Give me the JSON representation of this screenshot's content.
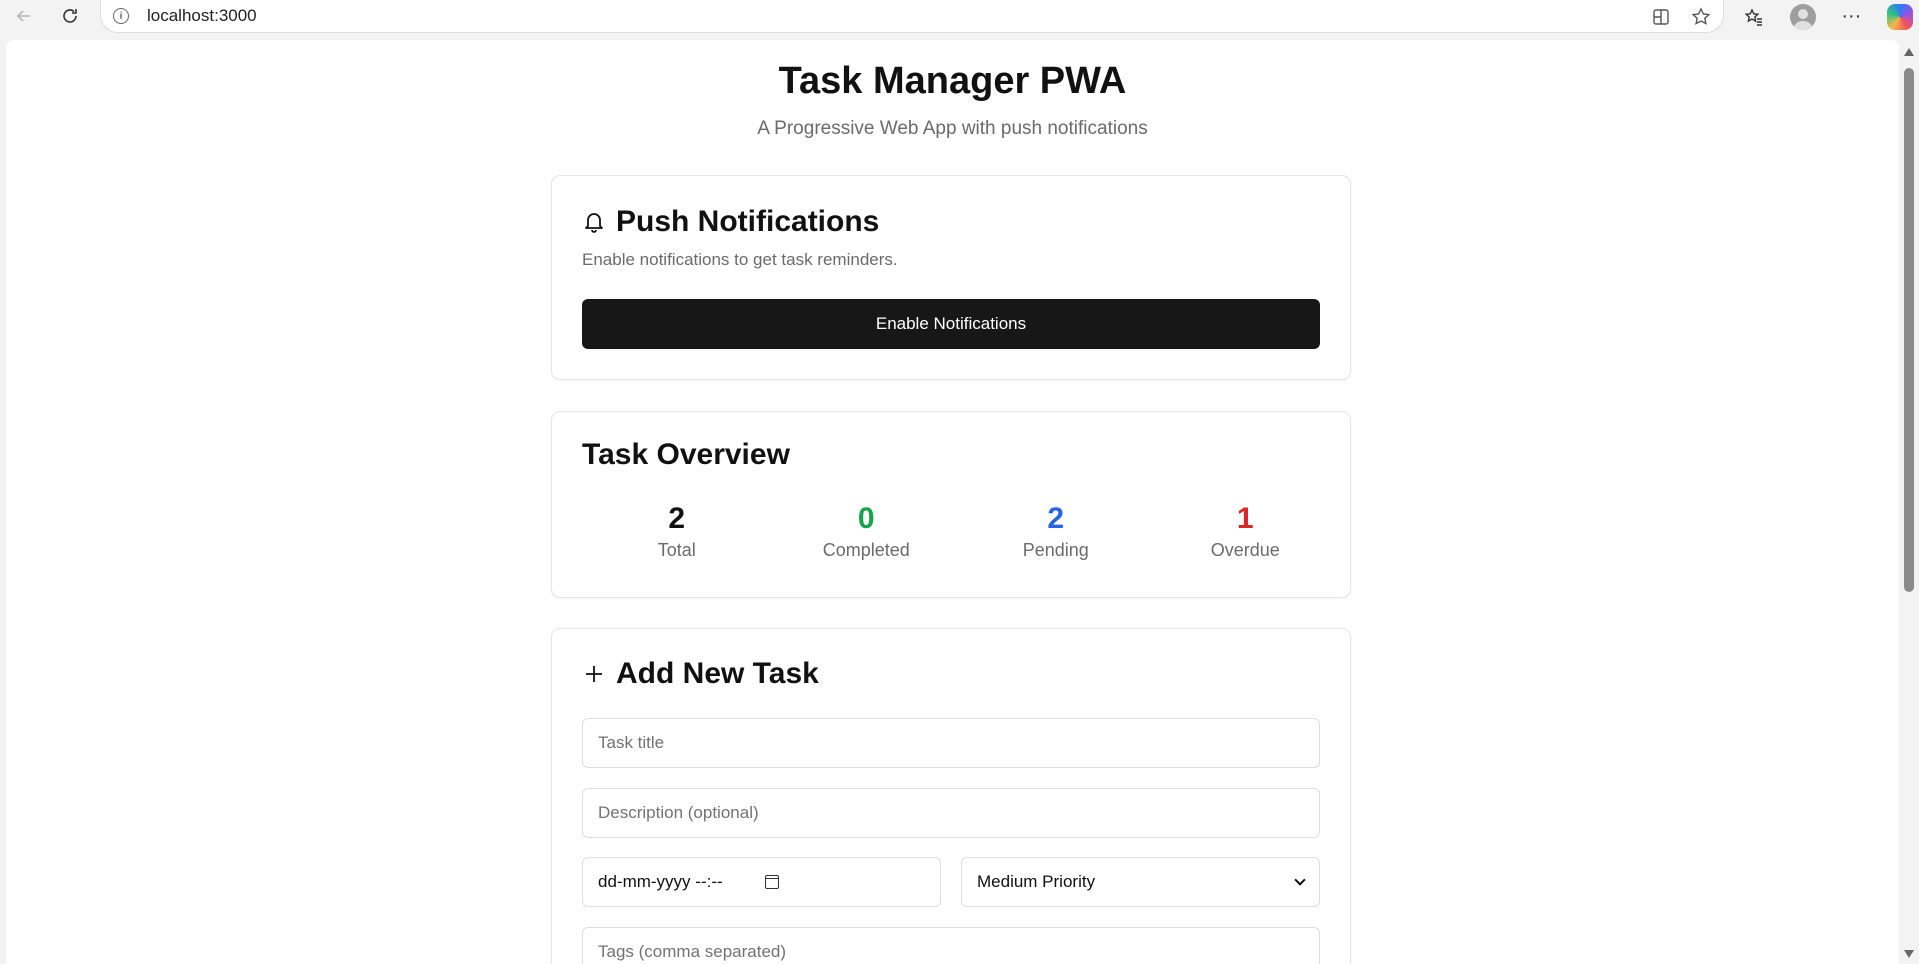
{
  "browser": {
    "url": "localhost:3000",
    "icons": [
      "back-arrow-icon",
      "reload-icon",
      "site-info-icon",
      "split-screen-icon",
      "favorite-star-icon",
      "favorites-icon",
      "profile-icon",
      "more-icon",
      "copilot-icon"
    ]
  },
  "header": {
    "title": "Task Manager PWA",
    "subtitle": "A Progressive Web App with push notifications"
  },
  "notifications": {
    "title": "Push Notifications",
    "description": "Enable notifications to get task reminders.",
    "button_label": "Enable Notifications",
    "icon": "bell-icon"
  },
  "overview": {
    "title": "Task Overview",
    "stats": [
      {
        "value": "2",
        "label": "Total",
        "color": "#111111"
      },
      {
        "value": "0",
        "label": "Completed",
        "color": "#16a34a"
      },
      {
        "value": "2",
        "label": "Pending",
        "color": "#2563eb"
      },
      {
        "value": "1",
        "label": "Overdue",
        "color": "#dc2626"
      }
    ]
  },
  "add_task": {
    "title": "Add New Task",
    "icon": "plus-icon",
    "title_placeholder": "Task title",
    "description_placeholder": "Description (optional)",
    "date_value": "dd-mm-yyyy --:--",
    "priority_selected": "Medium Priority",
    "tags_placeholder": "Tags (comma separated)"
  }
}
